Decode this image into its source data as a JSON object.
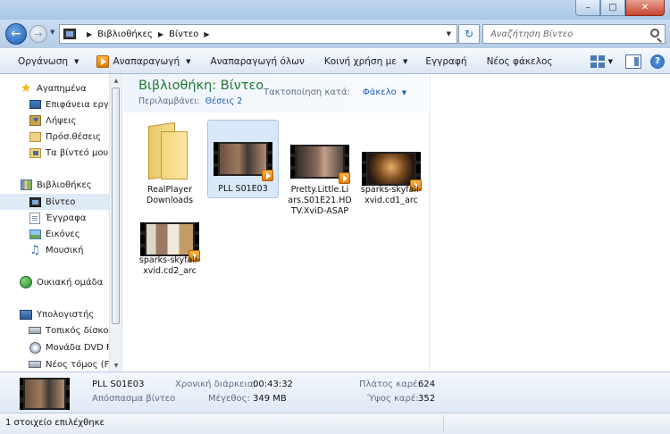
{
  "address": {
    "crumbs": [
      "Βιβλιοθήκες",
      "Βίντεο"
    ]
  },
  "search": {
    "placeholder": "Αναζήτηση Βίντεο"
  },
  "toolbar": {
    "organize": "Οργάνωση",
    "play": "Αναπαραγωγή",
    "play_all": "Αναπαραγωγή όλων",
    "share": "Κοινή χρήση με",
    "burn": "Εγγραφή",
    "new_folder": "Νέος φάκελος"
  },
  "nav": {
    "favorites": "Αγαπημένα",
    "desktop": "Επιφάνεια εργασ",
    "downloads": "Λήψεις",
    "recent": "Πρόσ.θέσεις",
    "my_videos": "Τα βίντεό μου",
    "libraries": "Βιβλιοθήκες",
    "videos": "Βίντεο",
    "documents": "Έγγραφα",
    "pictures": "Εικόνες",
    "music": "Μουσική",
    "homegroup": "Οικιακή ομάδα",
    "computer": "Υπολογιστής",
    "local_disk": "Τοπικός δίσκος",
    "dvd_drive": "Μονάδα DVD RW",
    "new_volume": "Νέος τόμος (F:)"
  },
  "library": {
    "title": "Βιβλιοθήκη: Βίντεο",
    "includes_label": "Περιλαμβάνει:",
    "locations": "Θέσεις 2",
    "arrange_label": "Τακτοποίηση κατά:",
    "arrange_value": "Φάκελο"
  },
  "items": [
    {
      "name": "RealPlayer Downloads",
      "line1": "RealPlayer",
      "line2": "Downloads",
      "type": "folder"
    },
    {
      "name": "PLL S01E03",
      "line1": "PLL S01E03",
      "type": "video",
      "selected": true
    },
    {
      "name": "Pretty.Little.Liars.S01E21.HDTV.XviD-ASAP",
      "line1": "Pretty.Little.Li",
      "line2": "ars.S01E21.HD",
      "line3": "TV.XviD-ASAP",
      "type": "video"
    },
    {
      "name": "sparks-skyfall-xvid.cd1_arc",
      "line1": "sparks-skyfall-",
      "line2": "xvid.cd1_arc",
      "type": "video"
    },
    {
      "name": "sparks-skyfall-xvid.cd2_arc",
      "line1": "sparks-skyfall-",
      "line2": "xvid.cd2_arc",
      "type": "video"
    }
  ],
  "details": {
    "name": "PLL S01E03",
    "type": "Απόσπασμα βίντεο",
    "duration_label": "Χρονική διάρκεια:",
    "duration": "00:43:32",
    "size_label": "Μέγεθος:",
    "size": "349 MB",
    "width_label": "Πλάτος καρέ:",
    "width": "624",
    "height_label": "Ύψος καρέ:",
    "height": "352"
  },
  "status": {
    "text": "1 στοιχείο επιλέχθηκε"
  }
}
